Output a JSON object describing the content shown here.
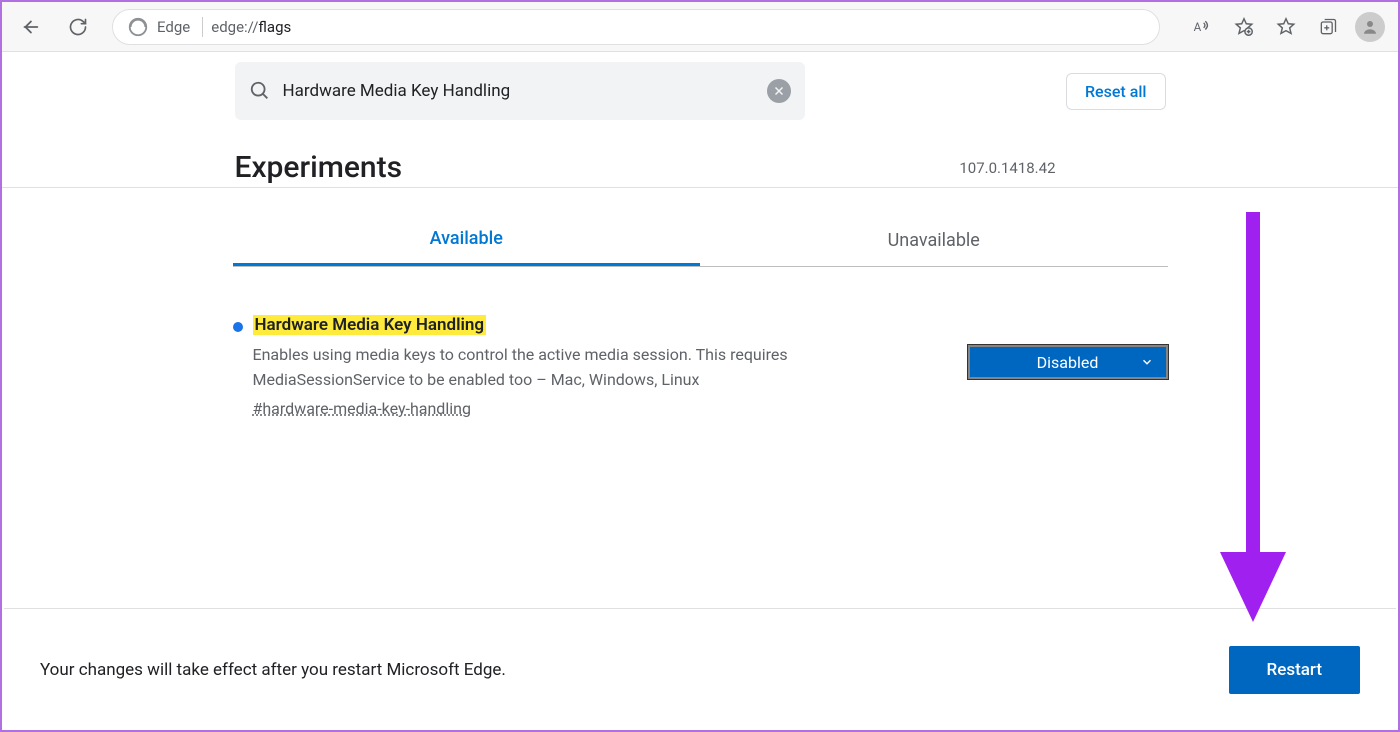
{
  "browser": {
    "label": "Edge",
    "url_prefix": "edge://",
    "url_path": "flags"
  },
  "search": {
    "value": "Hardware Media Key Handling",
    "reset_label": "Reset all"
  },
  "header": {
    "title": "Experiments",
    "version": "107.0.1418.42"
  },
  "tabs": {
    "available": "Available",
    "unavailable": "Unavailable"
  },
  "flag": {
    "title": "Hardware Media Key Handling",
    "description": "Enables using media keys to control the active media session. This requires MediaSessionService to be enabled too – Mac, Windows, Linux",
    "anchor": "#hardware-media-key-handling",
    "state": "Disabled"
  },
  "footer": {
    "message": "Your changes will take effect after you restart Microsoft Edge.",
    "button": "Restart"
  }
}
